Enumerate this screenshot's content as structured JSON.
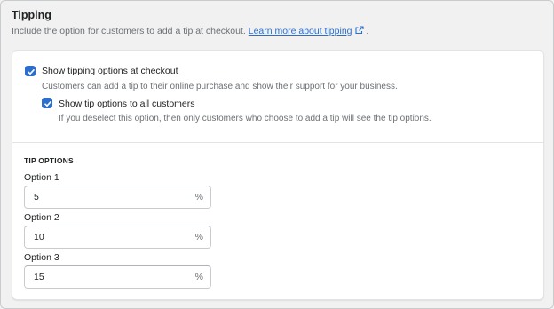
{
  "section": {
    "title": "Tipping",
    "subtitle_text": "Include the option for customers to add a tip at checkout.",
    "learn_more_link": "Learn more about tipping",
    "subtitle_end": "."
  },
  "checkboxes": {
    "show_tipping": {
      "label": "Show tipping options at checkout",
      "help": "Customers can add a tip to their online purchase and show their support for your business.",
      "checked": true
    },
    "show_all": {
      "label": "Show tip options to all customers",
      "help": "If you deselect this option, then only customers who choose to add a tip will see the tip options.",
      "checked": true
    }
  },
  "tip_options": {
    "title": "TIP OPTIONS",
    "options": [
      {
        "label": "Option 1",
        "value": "5",
        "suffix": "%"
      },
      {
        "label": "Option 2",
        "value": "10",
        "suffix": "%"
      },
      {
        "label": "Option 3",
        "value": "15",
        "suffix": "%"
      }
    ]
  },
  "colors": {
    "accent": "#2c6ecb",
    "text": "#202223",
    "subdued": "#6d7175",
    "background": "#f1f1f1",
    "card": "#ffffff"
  },
  "icons": {
    "external_link": "external-link-icon",
    "checkmark": "checkmark-icon"
  }
}
